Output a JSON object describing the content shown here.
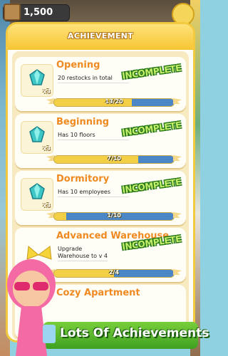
{
  "hud": {
    "coins": "1,500"
  },
  "dialog": {
    "title": "ACHIEVEMENT"
  },
  "achievements": [
    {
      "title": "Opening",
      "description": "20 restocks in total",
      "status": "INCOMPLETE",
      "progress_text": "13/20",
      "progress": 0.65,
      "reward": "x3",
      "reward_icon": "gem-icon"
    },
    {
      "title": "Beginning",
      "description": "Has 10 floors",
      "status": "INCOMPLETE",
      "progress_text": "7/10",
      "progress": 0.7,
      "reward": "x3",
      "reward_icon": "gem-icon"
    },
    {
      "title": "Dormitory",
      "description": "Has 10 employees",
      "status": "INCOMPLETE",
      "progress_text": "1/10",
      "progress": 0.1,
      "reward": "x3",
      "reward_icon": "gem-icon"
    },
    {
      "title": "Advanced Warehouse",
      "description": "Upgrade Warehouse to v 4",
      "status": "INCOMPLETE",
      "progress_text": "2/4",
      "progress": 0.5,
      "reward": "",
      "reward_icon": "gem-icon"
    },
    {
      "title": "Cozy Apartment",
      "description": "",
      "status": "",
      "progress_text": "",
      "progress": 0,
      "reward": "",
      "reward_icon": "gem-icon"
    }
  ],
  "promo": {
    "text": "Lots Of Achievements"
  },
  "colors": {
    "accent": "#f3c93d",
    "title_orange": "#ef8a22",
    "badge_green": "#2c7a1c",
    "bar_blue": "#4b86c7",
    "bar_yellow": "#f2cf45"
  }
}
